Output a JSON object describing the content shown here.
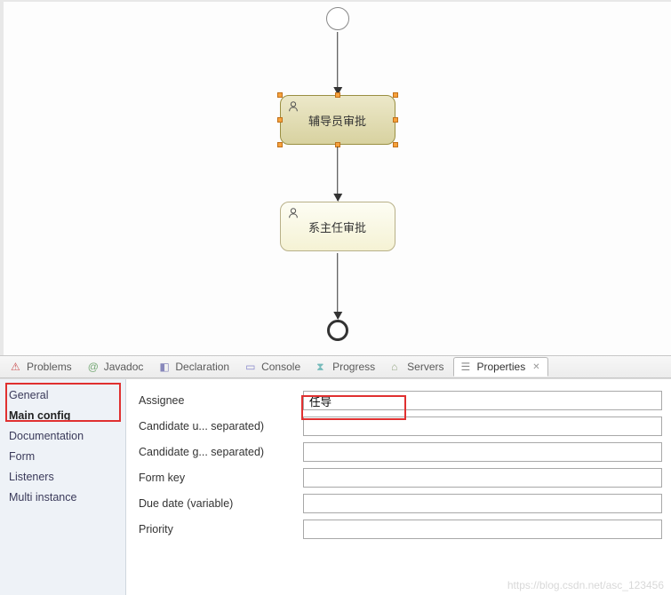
{
  "diagram": {
    "task1_label": "辅导员审批",
    "task2_label": "系主任审批"
  },
  "tabs": {
    "problems": "Problems",
    "javadoc": "Javadoc",
    "declaration": "Declaration",
    "console": "Console",
    "progress": "Progress",
    "servers": "Servers",
    "properties": "Properties"
  },
  "sidebar": {
    "items": [
      {
        "label": "General"
      },
      {
        "label": "Main config"
      },
      {
        "label": "Documentation"
      },
      {
        "label": "Form"
      },
      {
        "label": "Listeners"
      },
      {
        "label": "Multi instance"
      }
    ]
  },
  "form": {
    "assignee_label": "Assignee",
    "assignee_value": "任导",
    "cand_users_label": "Candidate u... separated)",
    "cand_users_value": "",
    "cand_groups_label": "Candidate g... separated)",
    "cand_groups_value": "",
    "formkey_label": "Form key",
    "formkey_value": "",
    "duedate_label": "Due date (variable)",
    "duedate_value": "",
    "priority_label": "Priority",
    "priority_value": ""
  },
  "watermark": "https://blog.csdn.net/asc_123456"
}
